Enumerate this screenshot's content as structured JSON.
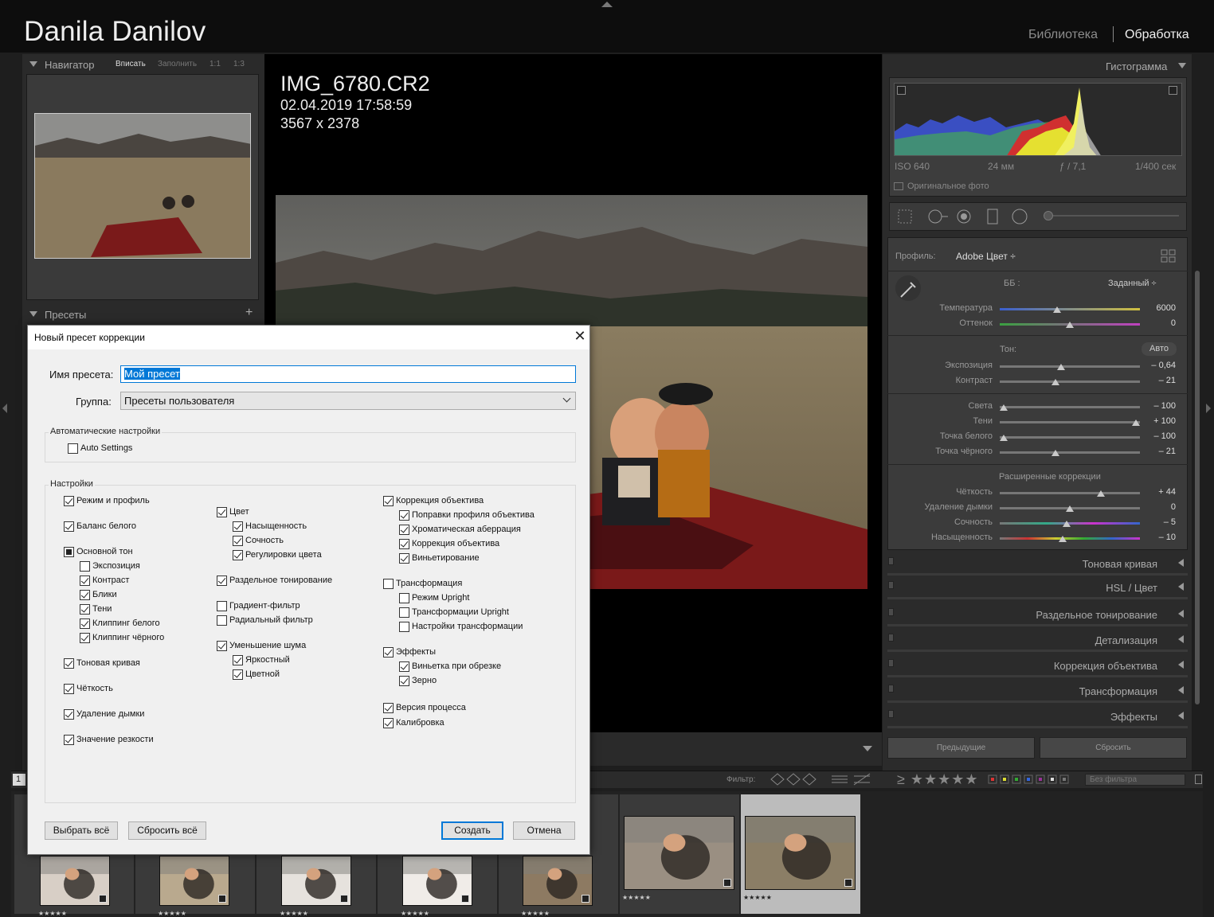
{
  "header": {
    "identity": "Danila Danilov",
    "modules": [
      "Библиотека",
      "Обработка"
    ]
  },
  "navigator": {
    "title": "Навигатор",
    "zoom": [
      "Вписать",
      "Заполнить",
      "1:1",
      "1:3"
    ]
  },
  "presets": {
    "title": "Пресеты",
    "add": "+"
  },
  "image": {
    "name": "IMG_6780.CR2",
    "date": "02.04.2019 17:58:59",
    "dimensions": "3567 x 2378"
  },
  "histogram": {
    "title": "Гистограмма",
    "iso": "ISO 640",
    "focal": "24 мм",
    "aperture": "ƒ / 7,1",
    "shutter": "1/400 сек",
    "original_photo": "Оригинальное фото"
  },
  "basic": {
    "profile_label": "Профиль:",
    "profile_value": "Adobe Цвет ÷",
    "wb_label": "ББ :",
    "wb_value": "Заданный ÷",
    "tone_label": "Тон:",
    "auto": "Авто",
    "advanced_label": "Расширенные коррекции",
    "sliders": [
      {
        "label": "Температура",
        "value": "6000",
        "pos": 0.41
      },
      {
        "label": "Оттенок",
        "value": "0",
        "pos": 0.5
      },
      {
        "label": "Экспозиция",
        "value": "– 0,64",
        "pos": 0.44
      },
      {
        "label": "Контраст",
        "value": "– 21",
        "pos": 0.4
      },
      {
        "label": "Света",
        "value": "– 100",
        "pos": 0.03
      },
      {
        "label": "Тени",
        "value": "+ 100",
        "pos": 0.97
      },
      {
        "label": "Точка белого",
        "value": "– 100",
        "pos": 0.03
      },
      {
        "label": "Точка чёрного",
        "value": "– 21",
        "pos": 0.4
      },
      {
        "label": "Чёткость",
        "value": "+ 44",
        "pos": 0.72
      },
      {
        "label": "Удаление дымки",
        "value": "0",
        "pos": 0.5
      },
      {
        "label": "Сочность",
        "value": "– 5",
        "pos": 0.48
      },
      {
        "label": "Насыщенность",
        "value": "– 10",
        "pos": 0.45
      }
    ]
  },
  "panels": [
    "Тоновая кривая",
    "HSL / Цвет",
    "Раздельное тонирование",
    "Детализация",
    "Коррекция объектива",
    "Трансформация",
    "Эффекты"
  ],
  "bottom_buttons": {
    "prev": "Предыдущие",
    "reset": "Сбросить"
  },
  "filterbar": {
    "page": "1",
    "label": "Фильтр:",
    "stars": "≥ ★★★★★",
    "select": "Без фильтра"
  },
  "filmstrip": {
    "stars": "★★★★★"
  },
  "dialog": {
    "title": "Новый пресет коррекции",
    "close": "✕",
    "name_label": "Имя пресета:",
    "name_value": "Мой пресет",
    "group_label": "Группа:",
    "group_value": "Пресеты пользователя",
    "auto_section": "Автоматические настройки",
    "auto_settings": "Auto Settings",
    "settings_section": "Настройки",
    "col1": [
      {
        "label": "Режим и профиль",
        "state": "on",
        "indent": 0,
        "row": 0
      },
      {
        "label": "Баланс белого",
        "state": "on",
        "indent": 0,
        "row": 1
      },
      {
        "label": "Основной тон",
        "state": "partial",
        "indent": 0,
        "row": 2
      },
      {
        "label": "Экспозиция",
        "state": "off",
        "indent": 1,
        "row": 3
      },
      {
        "label": "Контраст",
        "state": "on",
        "indent": 1,
        "row": 4
      },
      {
        "label": "Блики",
        "state": "on",
        "indent": 1,
        "row": 5
      },
      {
        "label": "Тени",
        "state": "on",
        "indent": 1,
        "row": 6
      },
      {
        "label": "Клиппинг белого",
        "state": "on",
        "indent": 1,
        "row": 7
      },
      {
        "label": "Клиппинг чёрного",
        "state": "on",
        "indent": 1,
        "row": 8
      },
      {
        "label": "Тоновая кривая",
        "state": "on",
        "indent": 0,
        "row": 9
      },
      {
        "label": "Чёткость",
        "state": "on",
        "indent": 0,
        "row": 10
      },
      {
        "label": "Удаление дымки",
        "state": "on",
        "indent": 0,
        "row": 11
      },
      {
        "label": "Значение резкости",
        "state": "on",
        "indent": 0,
        "row": 12
      }
    ],
    "col2": [
      {
        "label": "Цвет",
        "state": "on",
        "indent": 0
      },
      {
        "label": "Насыщенность",
        "state": "on",
        "indent": 1
      },
      {
        "label": "Сочность",
        "state": "on",
        "indent": 1
      },
      {
        "label": "Регулировки цвета",
        "state": "on",
        "indent": 1
      },
      {
        "label": "Раздельное тонирование",
        "state": "on",
        "indent": 0
      },
      {
        "label": "Градиент-фильтр",
        "state": "off",
        "indent": 0
      },
      {
        "label": "Радиальный фильтр",
        "state": "off",
        "indent": 0
      },
      {
        "label": "Уменьшение шума",
        "state": "on",
        "indent": 0
      },
      {
        "label": "Яркостный",
        "state": "on",
        "indent": 1
      },
      {
        "label": "Цветной",
        "state": "on",
        "indent": 1
      }
    ],
    "col3": [
      {
        "label": "Коррекция объектива",
        "state": "on",
        "indent": 0
      },
      {
        "label": "Поправки профиля объектива",
        "state": "on",
        "indent": 1
      },
      {
        "label": "Хроматическая аберрация",
        "state": "on",
        "indent": 1
      },
      {
        "label": "Коррекция объектива",
        "state": "on",
        "indent": 1
      },
      {
        "label": "Виньетирование",
        "state": "on",
        "indent": 1
      },
      {
        "label": "Трансформация",
        "state": "off",
        "indent": 0
      },
      {
        "label": "Режим Upright",
        "state": "off",
        "indent": 1
      },
      {
        "label": "Трансформации Upright",
        "state": "off",
        "indent": 1
      },
      {
        "label": "Настройки трансформации",
        "state": "off",
        "indent": 1
      },
      {
        "label": "Эффекты",
        "state": "on",
        "indent": 0
      },
      {
        "label": "Виньетка при обрезке",
        "state": "on",
        "indent": 1
      },
      {
        "label": "Зерно",
        "state": "on",
        "indent": 1
      },
      {
        "label": "Версия процесса",
        "state": "on",
        "indent": 0
      },
      {
        "label": "Калибровка",
        "state": "on",
        "indent": 0
      }
    ],
    "buttons": {
      "select_all": "Выбрать всё",
      "reset_all": "Сбросить всё",
      "create": "Создать",
      "cancel": "Отмена"
    }
  }
}
